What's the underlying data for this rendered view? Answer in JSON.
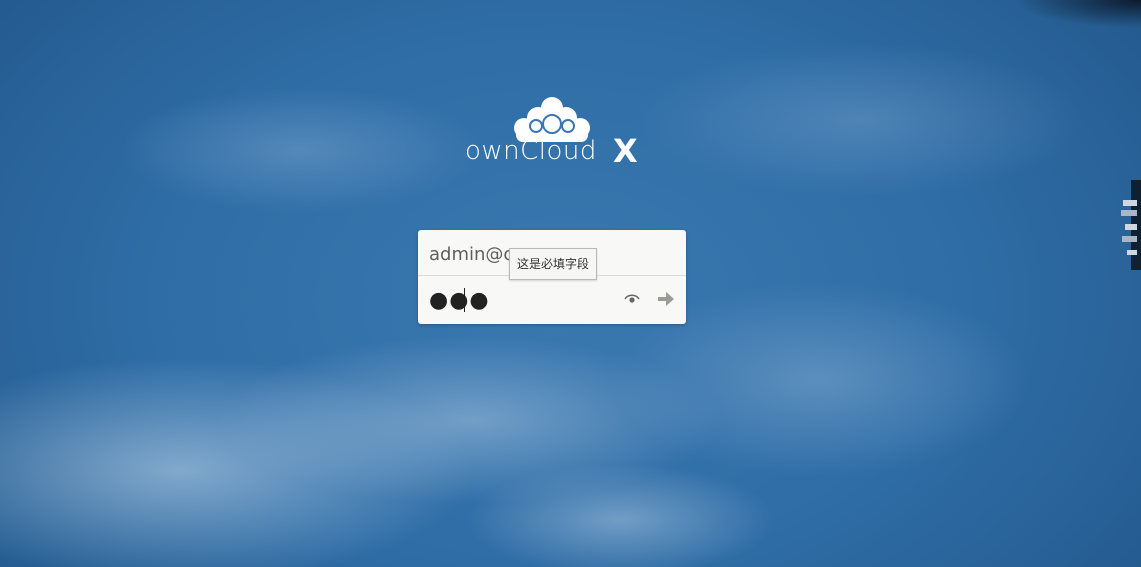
{
  "brand": {
    "name": "ownCloud",
    "mark": "X"
  },
  "login": {
    "username_value": "admin@o",
    "password_masked": "●●●",
    "tooltip": "这是必填字段"
  },
  "icons": {
    "cloud": "owncloud-logo-icon",
    "eye": "show-password-icon",
    "submit": "arrow-right-icon"
  },
  "colors": {
    "background": "#2f6da6",
    "form_bg": "#f8f8f6",
    "brand_text": "#ffffff"
  }
}
